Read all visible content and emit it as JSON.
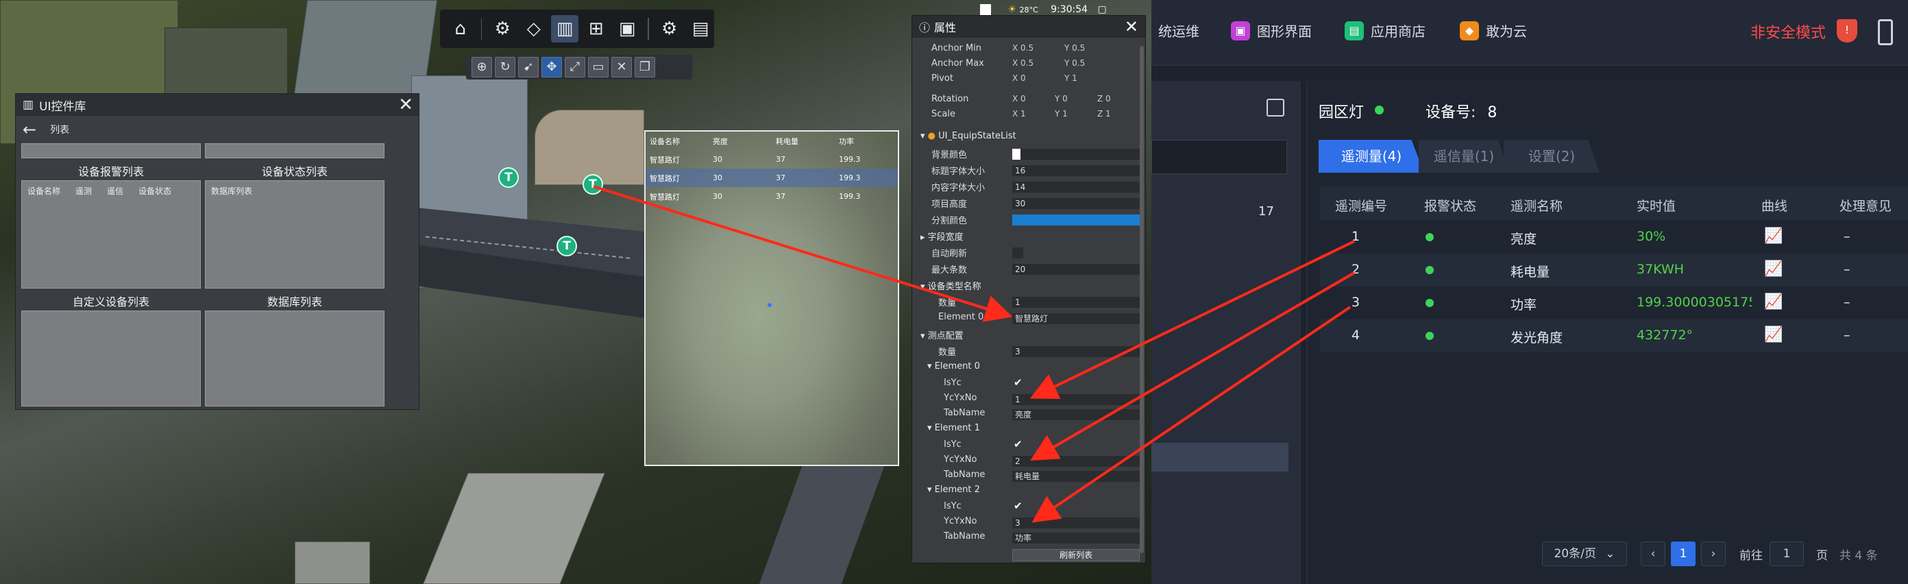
{
  "toolbar": {
    "icons": [
      "home-icon",
      "gear-cluster-icon",
      "cube-icon",
      "bar-chart-icon",
      "widget-grid-icon",
      "chart-panel-icon",
      "settings-icon",
      "save-icon"
    ],
    "sub_icons": [
      "target-icon",
      "rotate-icon",
      "pointer-icon",
      "move-icon",
      "scale-icon",
      "rect-icon",
      "delete-icon",
      "copy-icon"
    ]
  },
  "uilib": {
    "title": "UI控件库",
    "back_label": "列表",
    "cells": [
      {
        "label": "设备报警列表",
        "headers": [
          "设备名称",
          "遥测",
          "遥信",
          "设备状态"
        ]
      },
      {
        "label": "设备状态列表",
        "headers": [
          "数据库列表"
        ]
      },
      {
        "label": "自定义设备列表",
        "headers": []
      },
      {
        "label": "数据库列表",
        "headers": []
      }
    ]
  },
  "preview": {
    "headers": [
      "设备名称",
      "亮度",
      "耗电量",
      "功率"
    ],
    "rows": [
      [
        "智慧路灯",
        "30",
        "37",
        "199.3"
      ],
      [
        "智慧路灯",
        "30",
        "37",
        "199.3"
      ],
      [
        "智慧路灯",
        "30",
        "37",
        "199.3"
      ]
    ]
  },
  "status": {
    "weather": "28°C",
    "time": "9:30:54"
  },
  "props": {
    "title": "属性",
    "anchor_min": {
      "label": "Anchor Min",
      "x": "X 0.5",
      "y": "Y 0.5"
    },
    "anchor_max": {
      "label": "Anchor Max",
      "x": "X 0.5",
      "y": "Y 0.5"
    },
    "pivot": {
      "label": "Pivot",
      "x": "X 0",
      "y": "Y 1"
    },
    "rotation": {
      "label": "Rotation",
      "x": "X 0",
      "y": "Y 0",
      "z": "Z 0"
    },
    "scale": {
      "label": "Scale",
      "x": "X 1",
      "y": "Y 1",
      "z": "Z 1"
    },
    "component": "UI_EquipStateList",
    "bg_color_label": "背景颜色",
    "title_font_label": "标题字体大小",
    "title_font": "16",
    "content_font_label": "内容字体大小",
    "content_font": "14",
    "item_height_label": "项目高度",
    "item_height": "30",
    "divider_color_label": "分割颜色",
    "field_width_label": "字段宽度",
    "auto_refresh_label": "自动刷新",
    "max_items_label": "最大条数",
    "max_items": "20",
    "device_type_label": "设备类型名称",
    "count_label": "数量",
    "device_count": "1",
    "element0_label": "Element 0",
    "element0_value": "智慧路灯",
    "points_label": "测点配置",
    "points_count": "3",
    "elements": [
      {
        "name": "Element 0",
        "isyc": "IsYc",
        "ycyxno_label": "YcYxNo",
        "ycyxno": "1",
        "tabname_label": "TabName",
        "tabname": "亮度"
      },
      {
        "name": "Element 1",
        "isyc": "IsYc",
        "ycyxno_label": "YcYxNo",
        "ycyxno": "2",
        "tabname_label": "TabName",
        "tabname": "耗电量"
      },
      {
        "name": "Element 2",
        "isyc": "IsYc",
        "ycyxno_label": "YcYxNo",
        "ycyxno": "3",
        "tabname_label": "TabName",
        "tabname": "功率"
      }
    ],
    "refresh_label": "刷新列表"
  },
  "nav": {
    "items": [
      {
        "label": "统运维",
        "color": "#2f6fe8"
      },
      {
        "label": "图形界面",
        "color": "#c040d8"
      },
      {
        "label": "应用商店",
        "color": "#1fbf7a"
      },
      {
        "label": "敢为云",
        "color": "#f08a1c"
      }
    ],
    "unsafe_label": "非安全模式"
  },
  "mid": {
    "count": "17"
  },
  "device": {
    "name": "园区灯",
    "no_label": "设备号:",
    "no": "8",
    "tabs": [
      "遥测量(4)",
      "遥信量(1)",
      "设置(2)"
    ],
    "columns": [
      "遥测编号",
      "报警状态",
      "遥测名称",
      "实时值",
      "曲线",
      "处理意见"
    ],
    "rows": [
      {
        "no": "1",
        "name": "亮度",
        "value": "30%",
        "advice": "–"
      },
      {
        "no": "2",
        "name": "耗电量",
        "value": "37KWH",
        "advice": "–"
      },
      {
        "no": "3",
        "name": "功率",
        "value": "199.30000305175...",
        "advice": "–"
      },
      {
        "no": "4",
        "name": "发光角度",
        "value": "432772°",
        "advice": "–"
      }
    ]
  },
  "pagination": {
    "page_size": "20条/页",
    "current": "1",
    "goto_label": "前往",
    "goto_value": "1",
    "page_unit": "页",
    "total": "共 4 条"
  }
}
